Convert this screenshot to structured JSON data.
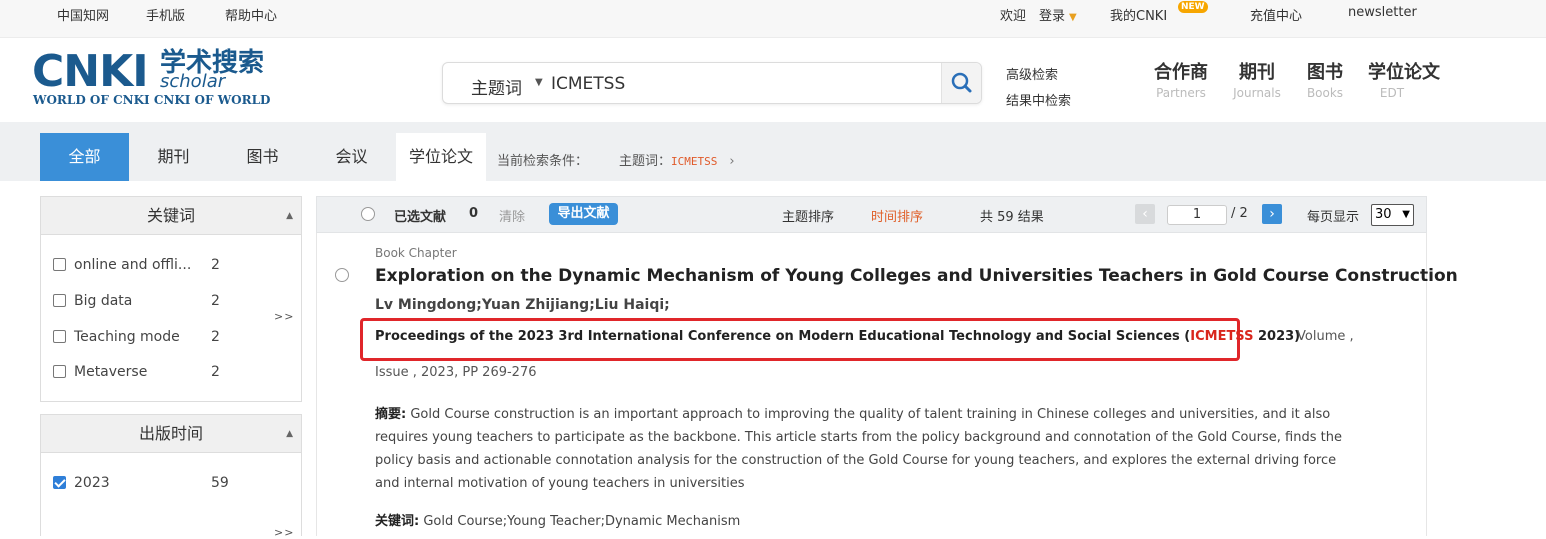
{
  "topbar": {
    "left_links": [
      "中国知网",
      "手机版",
      "帮助中心"
    ],
    "welcome": "欢迎",
    "login": "登录",
    "my_cnki": "我的CNKI",
    "new_badge": "NEW",
    "recharge": "充值中心",
    "newsletter": "newsletter"
  },
  "logo": {
    "cnki": "CNKI",
    "cn": "学术搜索",
    "scholar": "scholar",
    "sub": "WORLD OF CNKI CNKI OF WORLD"
  },
  "search": {
    "field": "主题词",
    "value": "ICMETSS",
    "advanced": "高级检索",
    "within": "结果中检索"
  },
  "nav": [
    {
      "cn": "合作商",
      "en": "Partners"
    },
    {
      "cn": "期刊",
      "en": "Journals"
    },
    {
      "cn": "图书",
      "en": "Books"
    },
    {
      "cn": "学位论文",
      "en": "EDT"
    }
  ],
  "tabs": [
    "全部",
    "期刊",
    "图书",
    "会议",
    "学位论文"
  ],
  "condition": {
    "label": "当前检索条件：",
    "field": "主题词：",
    "keyword": "ICMETSS"
  },
  "sidebar": {
    "keywords_title": "关键词",
    "keywords": [
      {
        "label": "online and offli...",
        "count": "2"
      },
      {
        "label": "Big data",
        "count": "2"
      },
      {
        "label": "Teaching mode",
        "count": "2"
      },
      {
        "label": "Metaverse",
        "count": "2"
      }
    ],
    "more": ">>",
    "year_title": "出版时间",
    "years": [
      {
        "label": "2023",
        "count": "59",
        "checked": true
      }
    ]
  },
  "results_bar": {
    "selected": "已选文献",
    "selected_count": "0",
    "clear": "清除",
    "export": "导出文献",
    "sort_topic": "主题排序",
    "sort_time": "时间排序",
    "total": "共 59 结果",
    "page": "1",
    "page_total": "/ 2",
    "per_page_label": "每页显示",
    "per_page": "30"
  },
  "result": {
    "type": "Book Chapter",
    "title": "Exploration on the Dynamic Mechanism of Young Colleges and Universities Teachers in Gold Course Construction",
    "authors": "Lv Mingdong;Yuan Zhijiang;Liu Haiqi;",
    "source_prefix": "Proceedings of the 2023 3rd International Conference on Modern Educational Technology and Social Sciences (",
    "source_highlight": "ICMETSS",
    "source_suffix": " 2023)",
    "volume": "Volume ,",
    "issue": "Issue , 2023, PP 269-276",
    "abstract_label": "摘要:",
    "abstract": "Gold Course construction is an important approach to improving the quality of talent training in Chinese colleges and universities, and it also requires young teachers to participate as the backbone. This article starts from the policy background and connotation of the Gold Course, finds the policy basis and actionable connotation analysis for the construction of the Gold Course for young teachers, and explores the external driving force and internal motivation of young teachers in universities",
    "keywords_label": "关键词:",
    "keywords": "Gold Course;Young Teacher;Dynamic Mechanism"
  },
  "colors": {
    "accent": "#3a8fd8",
    "brand": "#1b5a8e",
    "highlight": "#d9261c",
    "box": "#e0262a"
  }
}
